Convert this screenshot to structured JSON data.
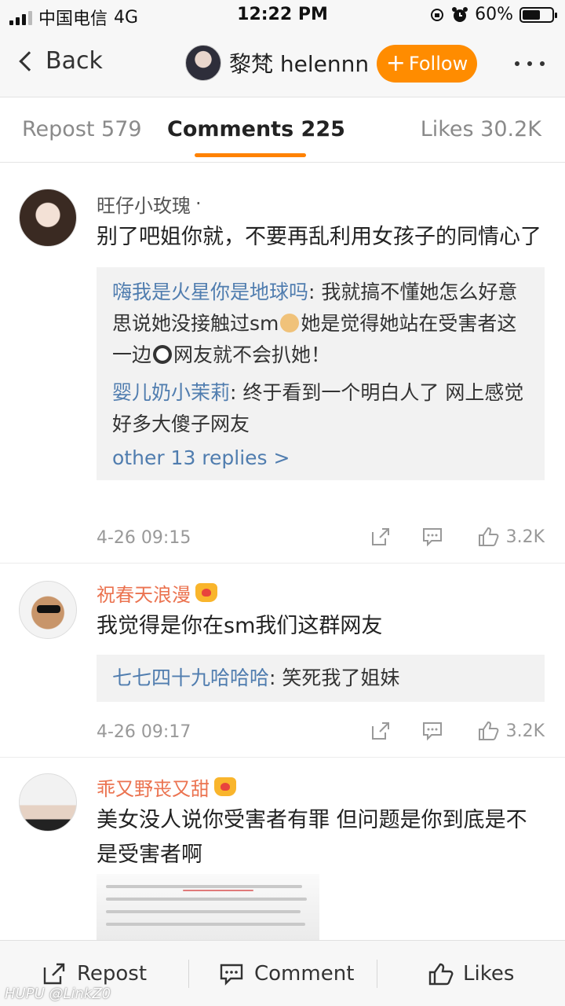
{
  "status_bar": {
    "carrier": "中国电信",
    "network": "4G",
    "time": "12:22 PM",
    "battery": "60%",
    "battery_level": 0.6
  },
  "nav": {
    "back_label": "Back",
    "username": "黎梵 helennn",
    "follow_label": "Follow",
    "follow_plus": "+"
  },
  "tabs": {
    "repost": "Repost 579",
    "comments": "Comments 225",
    "likes": "Likes 30.2K"
  },
  "comments": [
    {
      "user": "旺仔小玫瑰",
      "user_suffix": "·",
      "text": "别了吧姐你就，不要再乱利用女孩子的同情心了",
      "replies": [
        {
          "user": "嗨我是火星你是地球吗",
          "text_a": ": 我就搞不懂她怎么好意思说她没接触过sm",
          "text_b": "她是觉得她站在受害者这一边",
          "text_c": "网友就不会扒她！"
        },
        {
          "user": "婴儿奶小茉莉",
          "text": ": 终于看到一个明白人了 网上感觉好多大傻子网友"
        }
      ],
      "more_replies": "other 13 replies >",
      "time": "4-26 09:15",
      "likes": "3.2K"
    },
    {
      "user": "祝春天浪漫",
      "text": "我觉得是你在sm我们这群网友",
      "replies": [
        {
          "user": "七七四十九哈哈哈",
          "text": ": 笑死我了姐妹"
        }
      ],
      "time": "4-26 09:17",
      "likes": "3.2K"
    },
    {
      "user": "乖又野丧又甜",
      "text": "美女没人说你受害者有罪 但问题是你到底是不是受害者啊"
    }
  ],
  "bottom_bar": {
    "repost": "Repost",
    "comment": "Comment",
    "likes": "Likes"
  },
  "watermark": "HUPU @LinkZ0",
  "colors": {
    "accent": "#ff8200",
    "link": "#507daf",
    "vip_name": "#eb7350"
  }
}
